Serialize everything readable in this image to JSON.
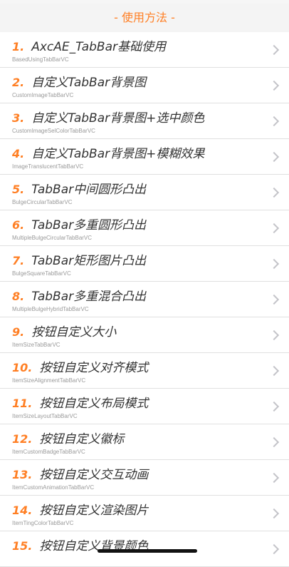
{
  "section": {
    "title": "- 使用方法 -"
  },
  "items": [
    {
      "num": "1.",
      "title": "AxcAE_TabBar基础使用",
      "subtitle": "BasedUsingTabBarVC"
    },
    {
      "num": "2.",
      "title": "自定义TabBar背景图",
      "subtitle": "CustomImageTabBarVC"
    },
    {
      "num": "3.",
      "title": "自定义TabBar背景图+选中颜色",
      "subtitle": "CustomImageSelColorTabBarVC"
    },
    {
      "num": "4.",
      "title": "自定义TabBar背景图+模糊效果",
      "subtitle": "ImageTranslucentTabBarVC"
    },
    {
      "num": "5.",
      "title": "TabBar中间圆形凸出",
      "subtitle": "BulgeCircularTabBarVC"
    },
    {
      "num": "6.",
      "title": "TabBar多重圆形凸出",
      "subtitle": "MultipleBulgeCircularTabBarVC"
    },
    {
      "num": "7.",
      "title": "TabBar矩形图片凸出",
      "subtitle": "BulgeSquareTabBarVC"
    },
    {
      "num": "8.",
      "title": "TabBar多重混合凸出",
      "subtitle": "MultipleBulgeHybridTabBarVC"
    },
    {
      "num": "9.",
      "title": "按钮自定义大小",
      "subtitle": "ItemSizeTabBarVC"
    },
    {
      "num": "10.",
      "title": "按钮自定义对齐模式",
      "subtitle": "ItemSizeAlignmentTabBarVC"
    },
    {
      "num": "11.",
      "title": "按钮自定义布局模式",
      "subtitle": "ItemSizeLayoutTabBarVC"
    },
    {
      "num": "12.",
      "title": "按钮自定义徽标",
      "subtitle": "ItemCustomBadgeTabBarVC"
    },
    {
      "num": "13.",
      "title": "按钮自定义交互动画",
      "subtitle": "ItemCustomAnimationTabBarVC"
    },
    {
      "num": "14.",
      "title": "按钮自定义渲染图片",
      "subtitle": "ItemTingColorTabBarVC"
    },
    {
      "num": "15.",
      "title": "按钮自定义背景颜色",
      "subtitle": ""
    }
  ],
  "icons": {
    "chevron": "chevron-right-icon"
  },
  "colors": {
    "accent": "#ff7f24",
    "title": "#333333",
    "subtitle": "#9a9a9a"
  }
}
